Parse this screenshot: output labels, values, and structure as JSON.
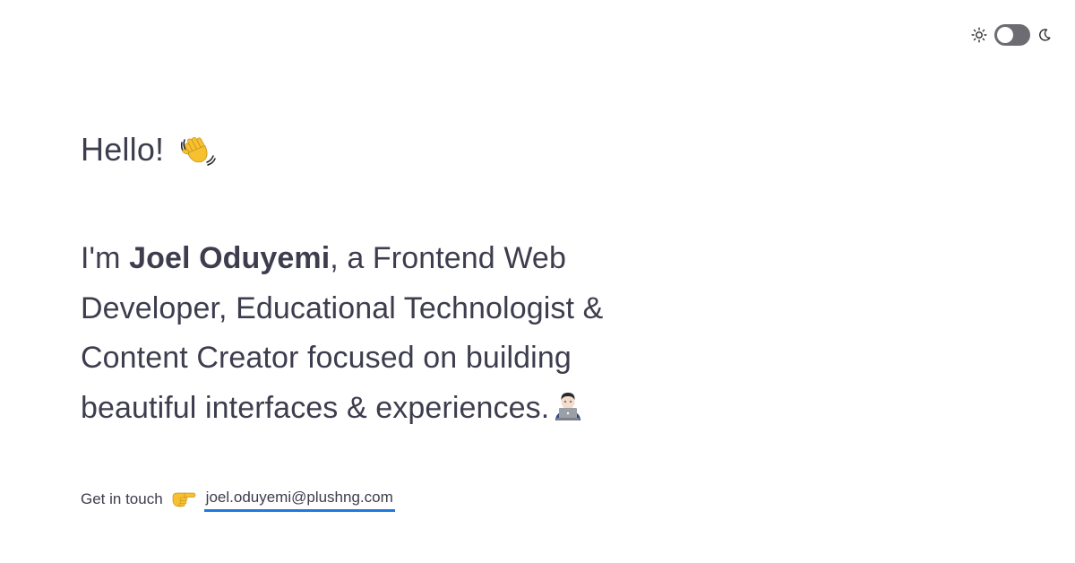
{
  "theme_toggle": {
    "light_icon": "sun-icon",
    "dark_icon": "moon-icon",
    "state": "light"
  },
  "greeting": {
    "text": "Hello!",
    "icon": "waving-hand-icon"
  },
  "intro": {
    "prefix": "I'm ",
    "name": "Joel Oduyemi",
    "description": ", a Frontend Web Developer, Educational Technologist & Content Creator focused on building beautiful interfaces & experiences.",
    "icon": "technologist-icon"
  },
  "contact": {
    "label": "Get in touch",
    "icon": "pointing-hand-icon",
    "email": "joel.oduyemi@plushng.com"
  },
  "colors": {
    "text": "#3d3d4e",
    "link_underline": "#1f7ae0",
    "toggle_track": "#6c6c72",
    "background": "#ffffff"
  }
}
